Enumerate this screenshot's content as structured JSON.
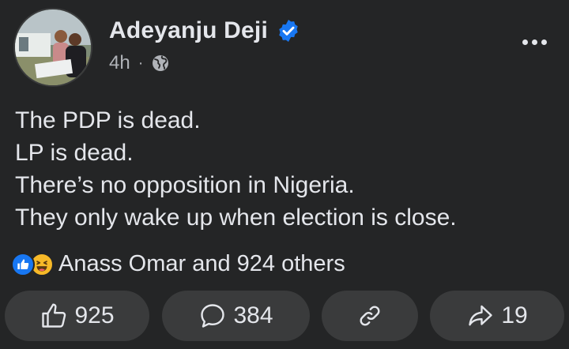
{
  "post": {
    "author": "Adeyanju Deji",
    "verified": true,
    "time": "4h",
    "separator": "·",
    "audience_icon": "globe-icon",
    "more_icon": "more-horizontal-icon",
    "lines": [
      "The PDP is dead.",
      "LP is dead.",
      "There’s no opposition in Nigeria.",
      "They only wake up when election is close."
    ]
  },
  "reactions": {
    "icons": [
      "like-reaction-icon",
      "haha-reaction-icon"
    ],
    "summary": "Anass Omar and 924 others"
  },
  "actions": {
    "like_count": "925",
    "comment_count": "384",
    "share_count": "19"
  },
  "colors": {
    "background": "#242526",
    "button_bg": "#3a3b3c",
    "text_primary": "#e4e6eb",
    "text_secondary": "#b0b3b8",
    "verified_blue": "#1877f2",
    "haha_yellow": "#f7b928"
  }
}
